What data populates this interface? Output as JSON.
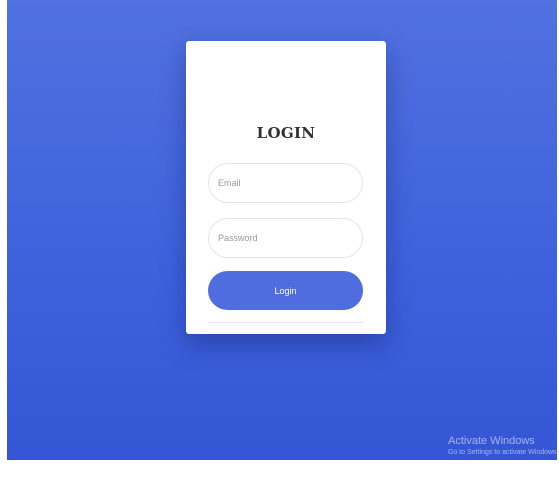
{
  "login": {
    "title": "LOGIN",
    "email_placeholder": "Email",
    "password_placeholder": "Password",
    "button_label": "Login"
  },
  "watermark": {
    "title": "Activate Windows",
    "subtitle": "Go to Settings to activate Windows."
  },
  "colors": {
    "background_top": "#5171e0",
    "background_bottom": "#3456d6",
    "button": "#506ddf",
    "card": "#ffffff"
  }
}
